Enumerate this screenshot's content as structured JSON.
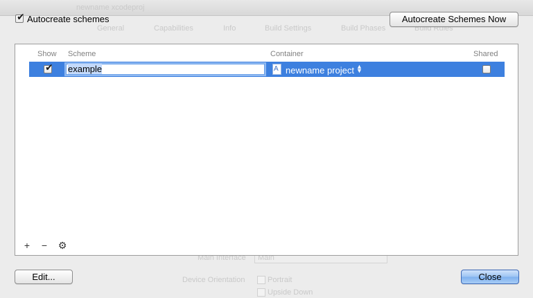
{
  "background": {
    "toolbar_title": "newname xcodeproj",
    "tabs": [
      "General",
      "Capabilities",
      "Info",
      "Build Settings",
      "Build Phases",
      "Build Rules"
    ],
    "main_interface_label": "Main Interface",
    "main_interface_value": "Main",
    "device_orientation_label": "Device Orientation",
    "orientations": [
      "Portrait",
      "Upside Down"
    ]
  },
  "sheet": {
    "autocreate_label": "Autocreate schemes",
    "autocreate_checked": true,
    "autocreate_now_label": "Autocreate Schemes Now",
    "columns": {
      "show": "Show",
      "scheme": "Scheme",
      "container": "Container",
      "shared": "Shared"
    },
    "rows": [
      {
        "show_checked": true,
        "scheme": "example",
        "container": "newname project",
        "shared_checked": false
      }
    ],
    "footer": {
      "add_icon": "+",
      "remove_icon": "−",
      "settings_icon": "gear-icon"
    },
    "edit_button_label": "Edit...",
    "close_button_label": "Close"
  },
  "colors": {
    "selection": "#3d80df",
    "default_button": "#9cc4f3"
  }
}
